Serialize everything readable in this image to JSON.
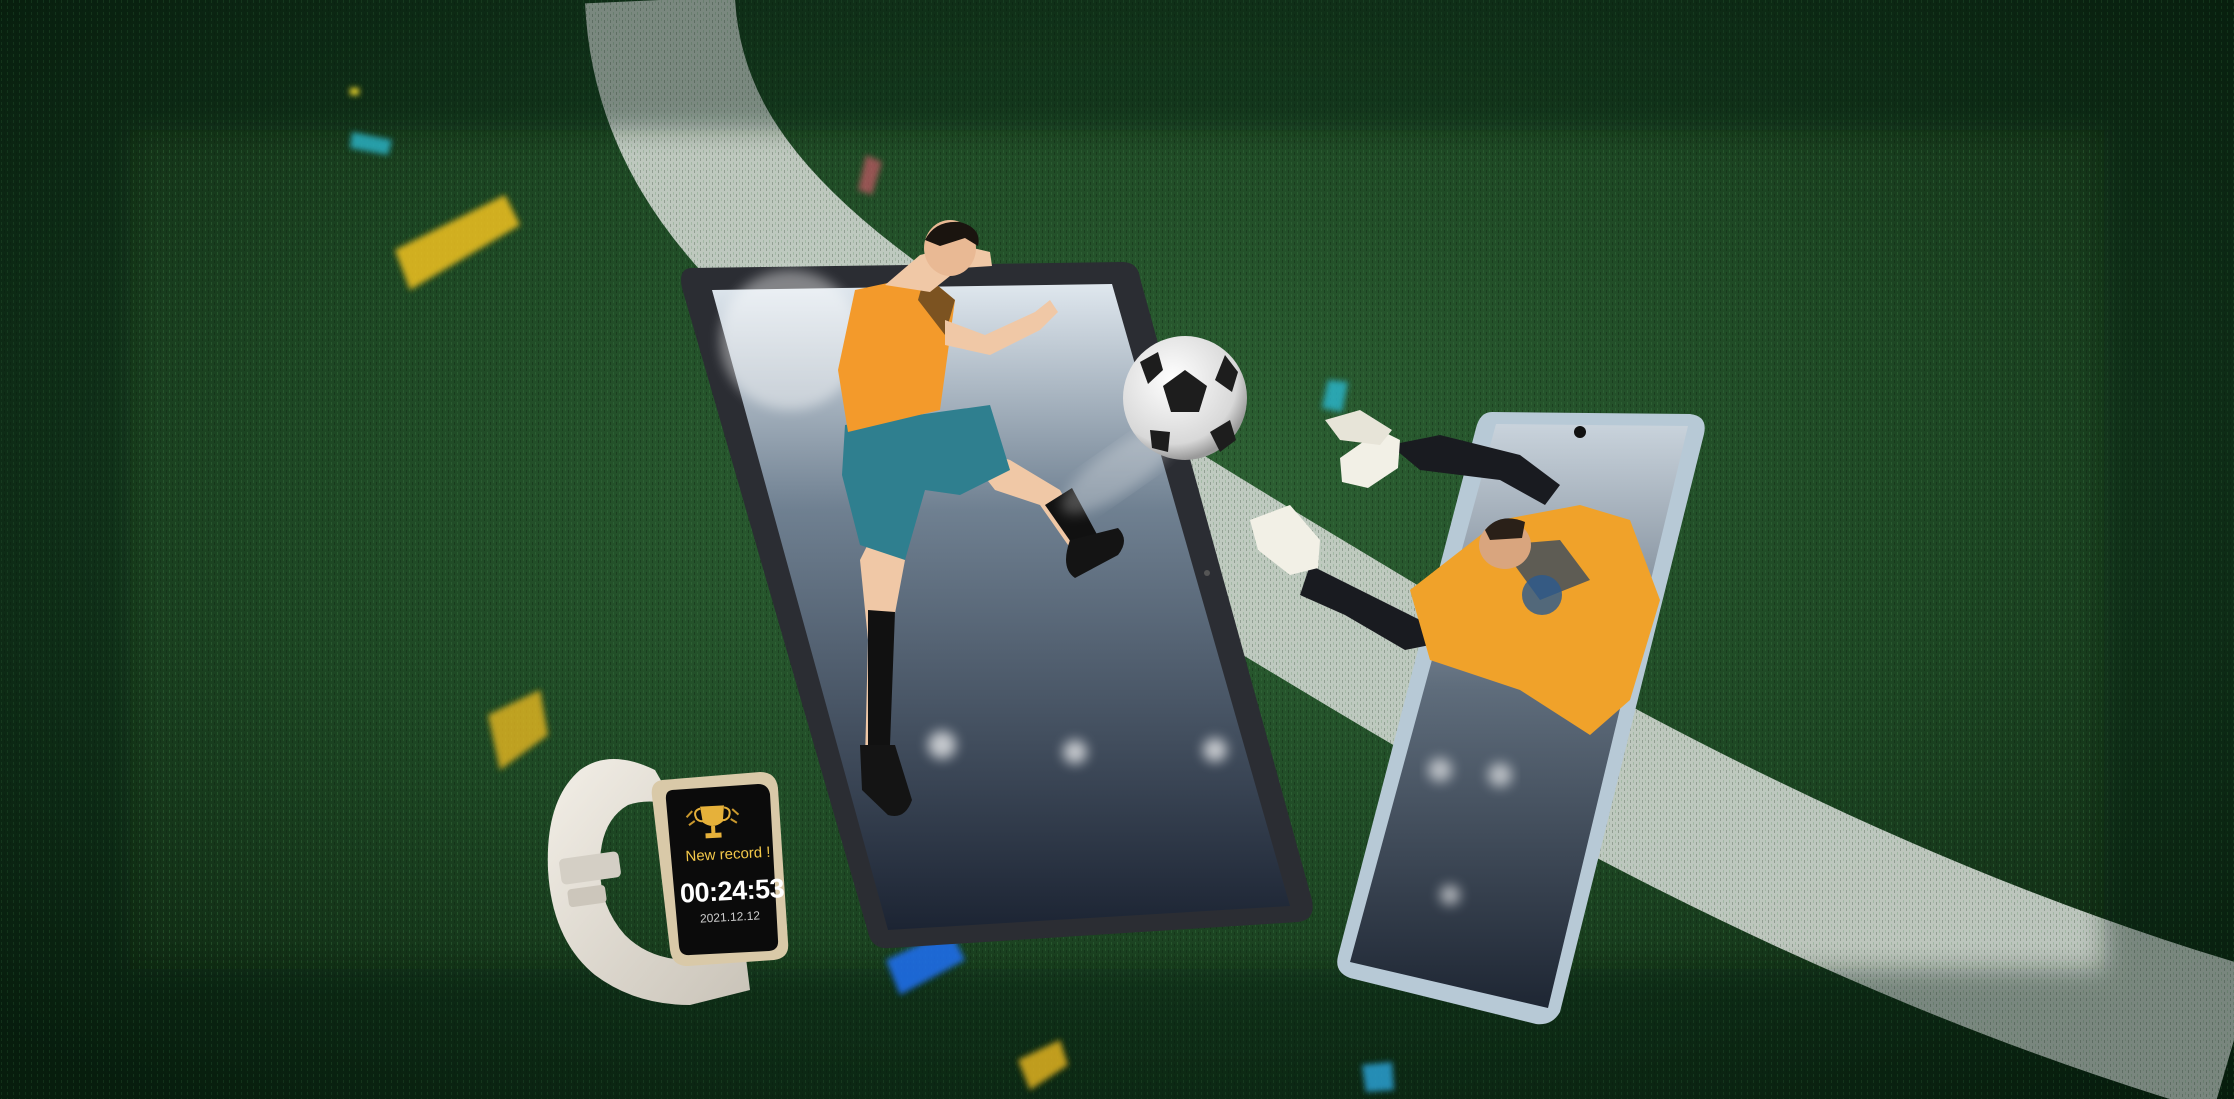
{
  "watch": {
    "message": "New record !",
    "time": "00:24:53",
    "date": "2021.12.12"
  },
  "colors": {
    "grass_dark": "#0d2610",
    "grass": "#24502a",
    "field_line": "#d7dcd7",
    "tablet_frame": "#2b2d33",
    "phone_frame": "#b7c9d6",
    "jersey_orange": "#f39a2b",
    "jersey_shorts": "#2f7f8f",
    "watch_band": "#e7e2d8",
    "trophy_gold": "#e6b13a"
  },
  "icons": [
    "trophy-icon",
    "soccer-ball",
    "confetti"
  ]
}
